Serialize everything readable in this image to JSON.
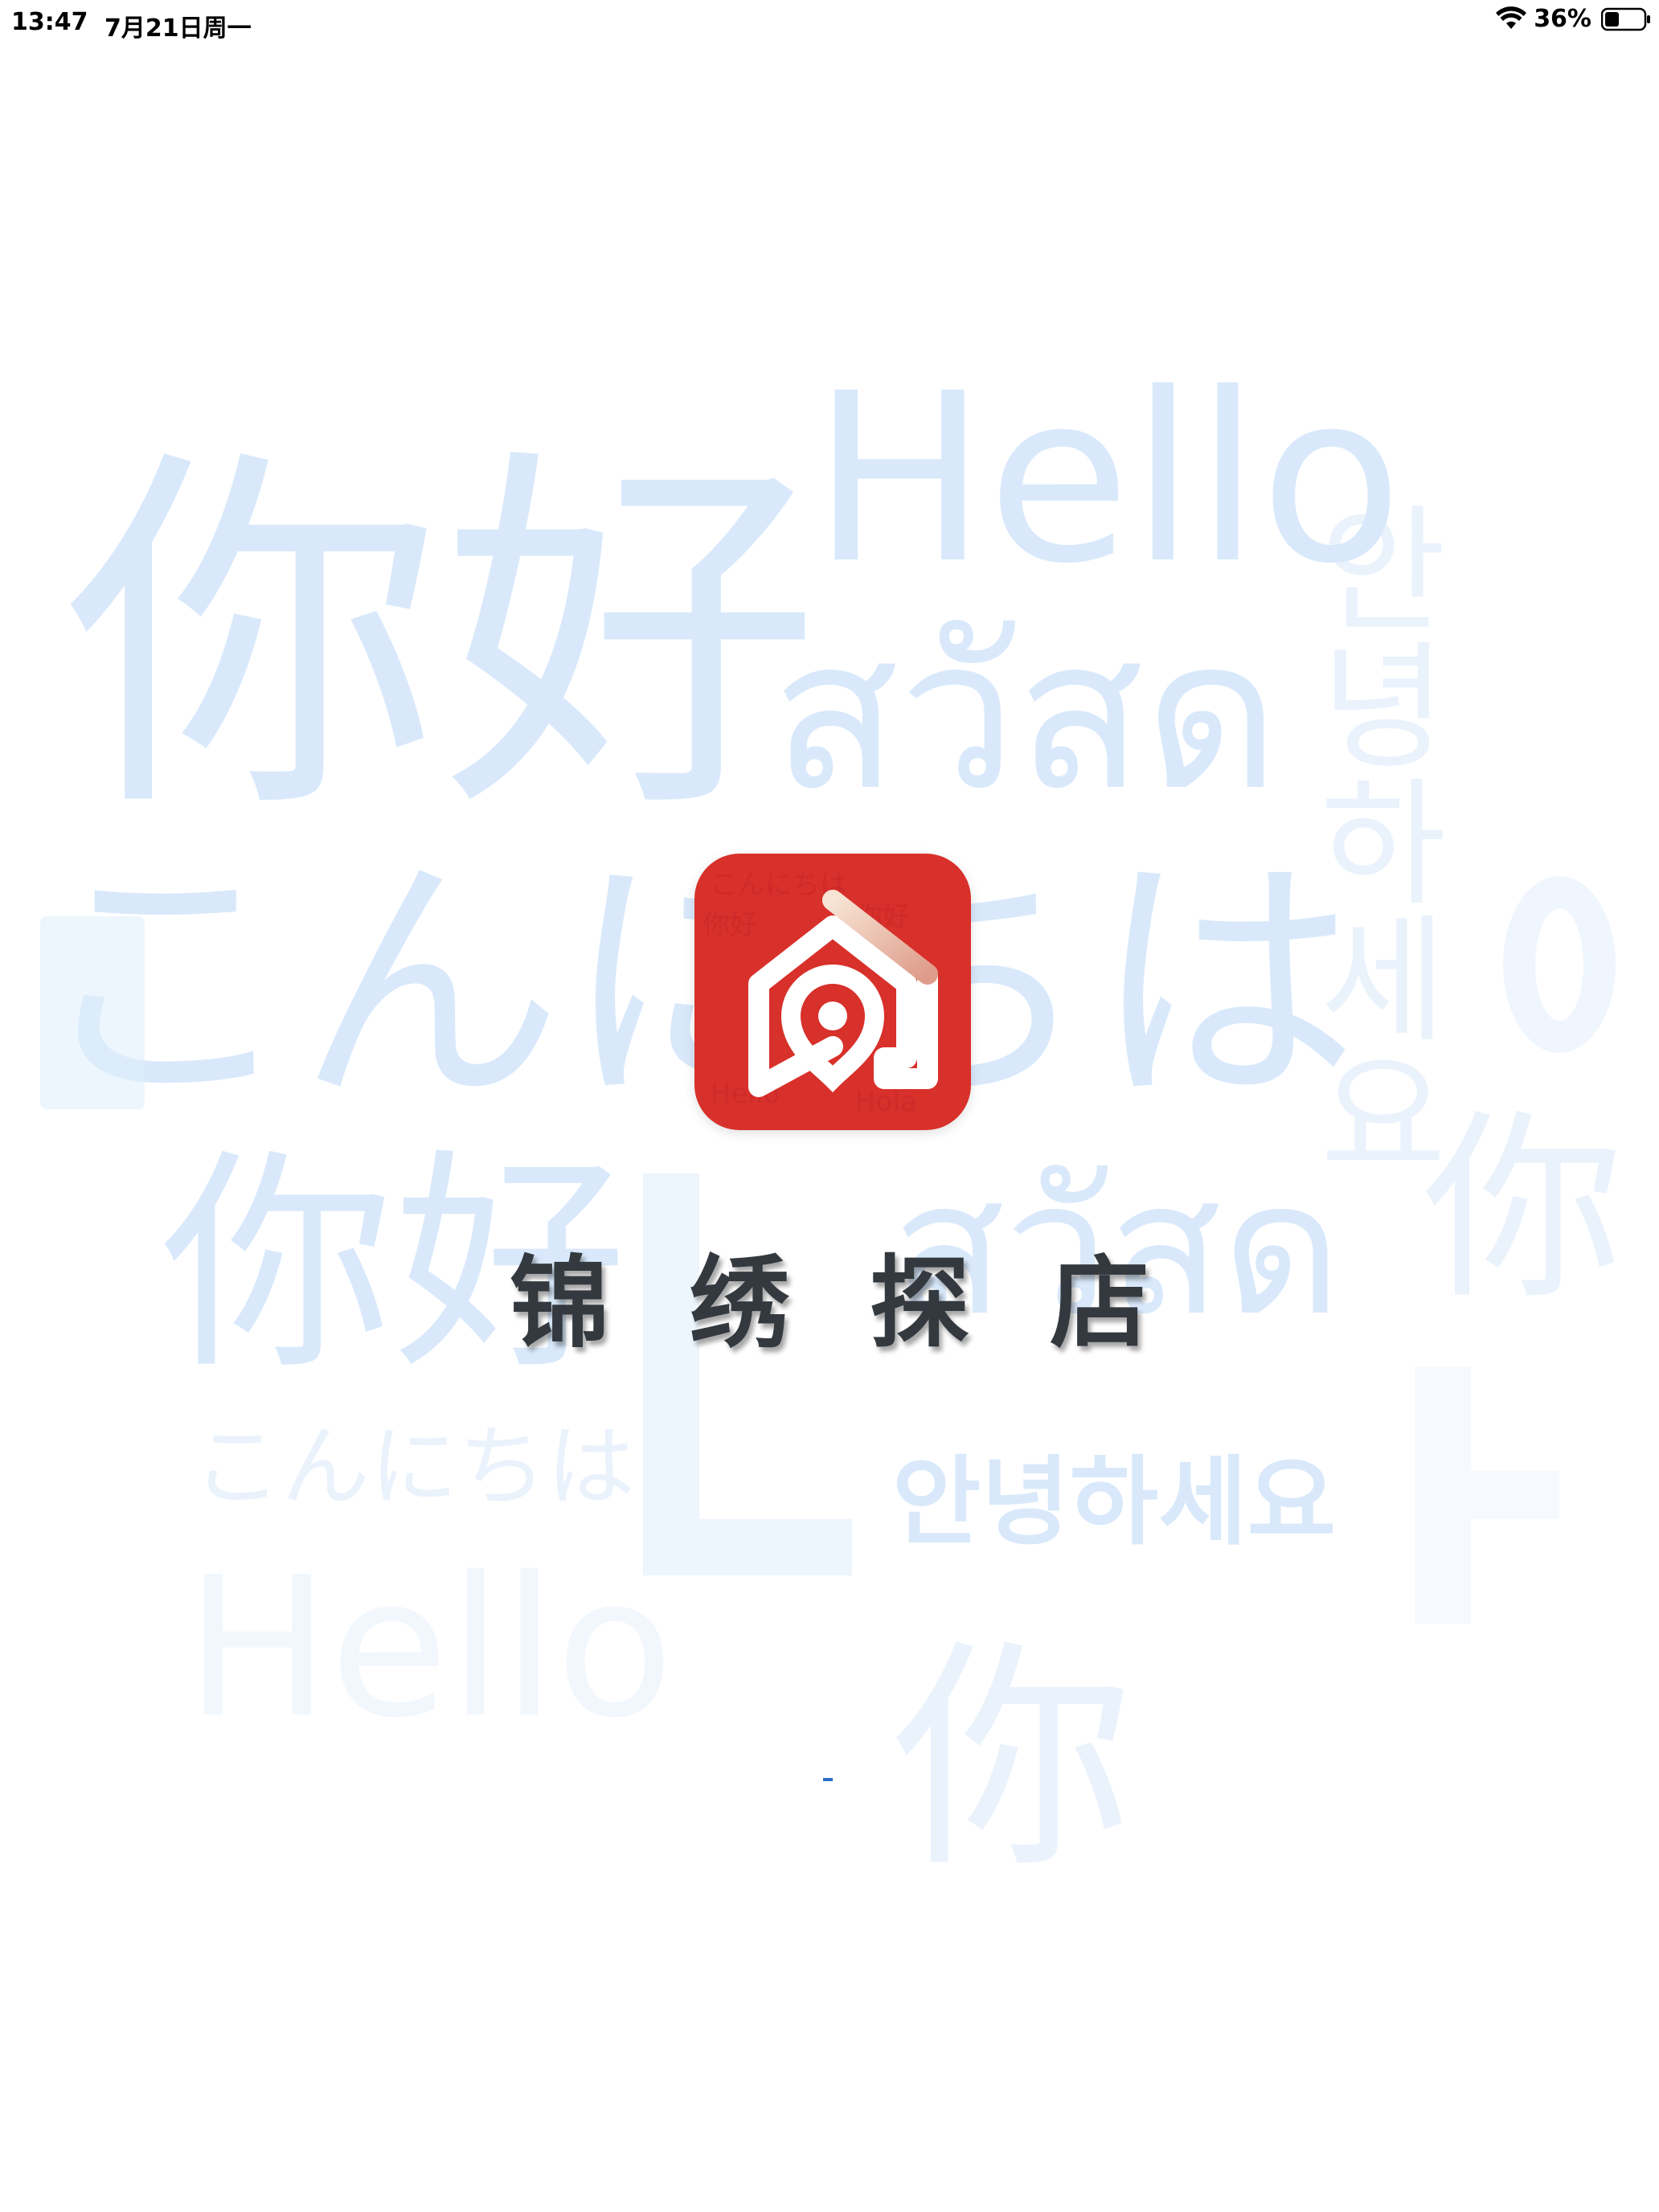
{
  "status_bar": {
    "time": "13:47",
    "date": "7月21日周一",
    "battery_percent": "36%",
    "battery_level": 0.36
  },
  "background_words": {
    "hello_top": "Hello",
    "nihao_big": "你好",
    "sawasdee_1": "สวัสด",
    "konnichiwa_big": "こんにちは",
    "korean_vertical": "안녕하세요",
    "nihao_mid": "你好",
    "sawasdee_2": "สวัสด",
    "konnichiwa_small": "こんにちは",
    "annyeong": "안녕하세요",
    "hello_bottom": "Hello",
    "nihao_bottom": "你",
    "nihao_right": "你"
  },
  "app": {
    "name": "锦绣探店",
    "logo_color": "#d8302a"
  }
}
